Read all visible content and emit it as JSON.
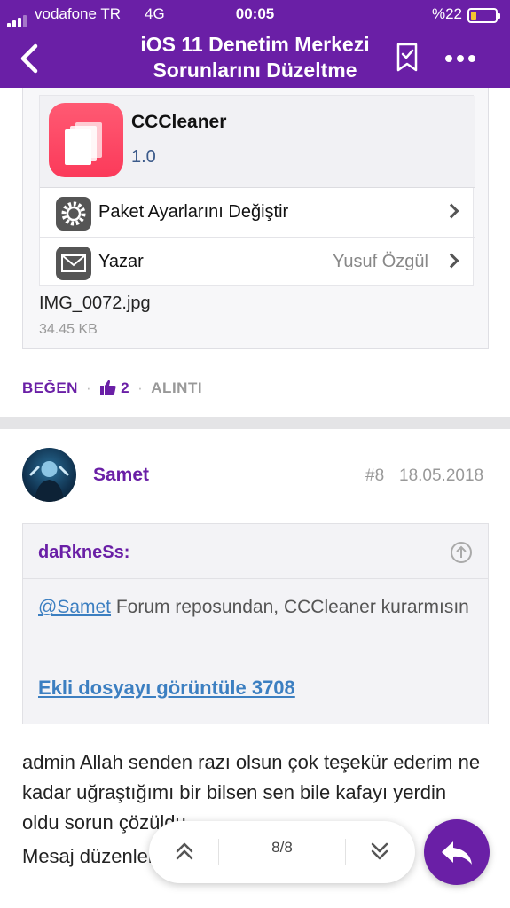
{
  "status_bar": {
    "carrier": "vodafone TR",
    "network": "4G",
    "time": "00:05",
    "battery": "%22",
    "battery_level": 0.22,
    "battery_color": "#f4c430"
  },
  "header": {
    "title_line1": "iOS 11 Denetim Merkezi",
    "title_line2": "Sorunlarını Düzeltme",
    "back_icon": "chevron-left-icon",
    "bookmark_icon": "bookmark-icon",
    "more_icon": "more-dots-icon",
    "accent": "#6a1fa6"
  },
  "attachment": {
    "package": {
      "name": "CCCleaner",
      "version": "1.0",
      "rows": [
        {
          "icon": "gear-icon",
          "label": "Paket Ayarlarını Değiştir",
          "value": ""
        },
        {
          "icon": "mail-icon",
          "label": "Yazar",
          "value": "Yusuf Özgül"
        }
      ]
    },
    "file_name": "IMG_0072.jpg",
    "file_size": "34.45 KB"
  },
  "actions": {
    "like_label": "BEĞEN",
    "like_count": "2",
    "quote_label": "ALINTI"
  },
  "post": {
    "username": "Samet",
    "number": "#8",
    "date": "18.05.2018",
    "quote": {
      "author": "daRkneSs:",
      "mention": "@Samet",
      "text_after_mention": " Forum reposundan, CCCleaner kurarmısın",
      "link": "Ekli dosyayı görüntüle 3708"
    },
    "body": "admin Allah senden razı olsun çok teşekür ederim ne kadar uğraştığımı bir bilsen sen bile kafayı yerdin oldu sorun çözüldu",
    "edit_note": "Mesaj düzenlendi"
  },
  "pager": {
    "label": "8/8"
  }
}
